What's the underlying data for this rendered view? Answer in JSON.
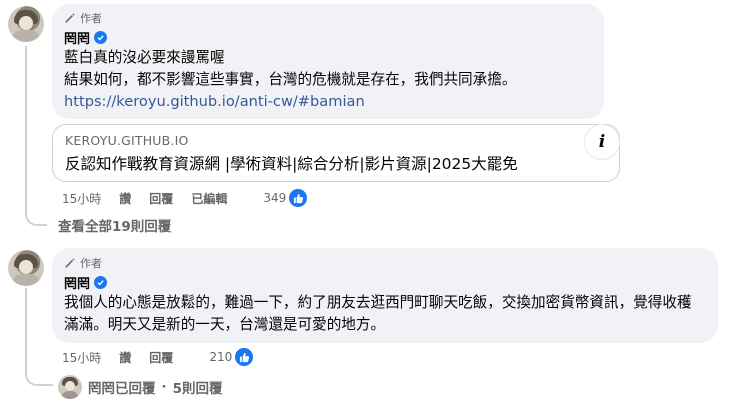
{
  "comment1": {
    "badge": "作者",
    "name": "罔罔",
    "lines": [
      "藍白真的沒必要來謾罵喔",
      "結果如何，都不影響這些事實，台灣的危機就是存在，我們共同承擔。"
    ],
    "link": "https://keroyu.github.io/anti-cw/#bamian",
    "preview": {
      "domain": "KEROYU.GITHUB.IO",
      "title": "反認知作戰教育資源網 |學術資料|綜合分析|影片資源|2025大罷免",
      "info_icon": "i"
    },
    "actions": {
      "time": "15小時",
      "like": "讚",
      "reply": "回覆",
      "edited": "已編輯",
      "reaction_count": "349"
    },
    "view_replies": "查看全部19則回覆"
  },
  "comment2": {
    "badge": "作者",
    "name": "罔罔",
    "text": "我個人的心態是放鬆的，難過一下，約了朋友去逛西門町聊天吃飯，交換加密貨幣資訊，覺得收穫滿滿。明天又是新的一天，台灣還是可愛的地方。",
    "actions": {
      "time": "15小時",
      "like": "讚",
      "reply": "回覆",
      "reaction_count": "210"
    },
    "replied": {
      "name": "罔罔已回覆",
      "separator": "·",
      "count": "5則回覆"
    }
  },
  "colors": {
    "bubble": "#f0f2f5",
    "link": "#385898",
    "like_blue": "#1877f2",
    "secondary_text": "#65676b"
  }
}
